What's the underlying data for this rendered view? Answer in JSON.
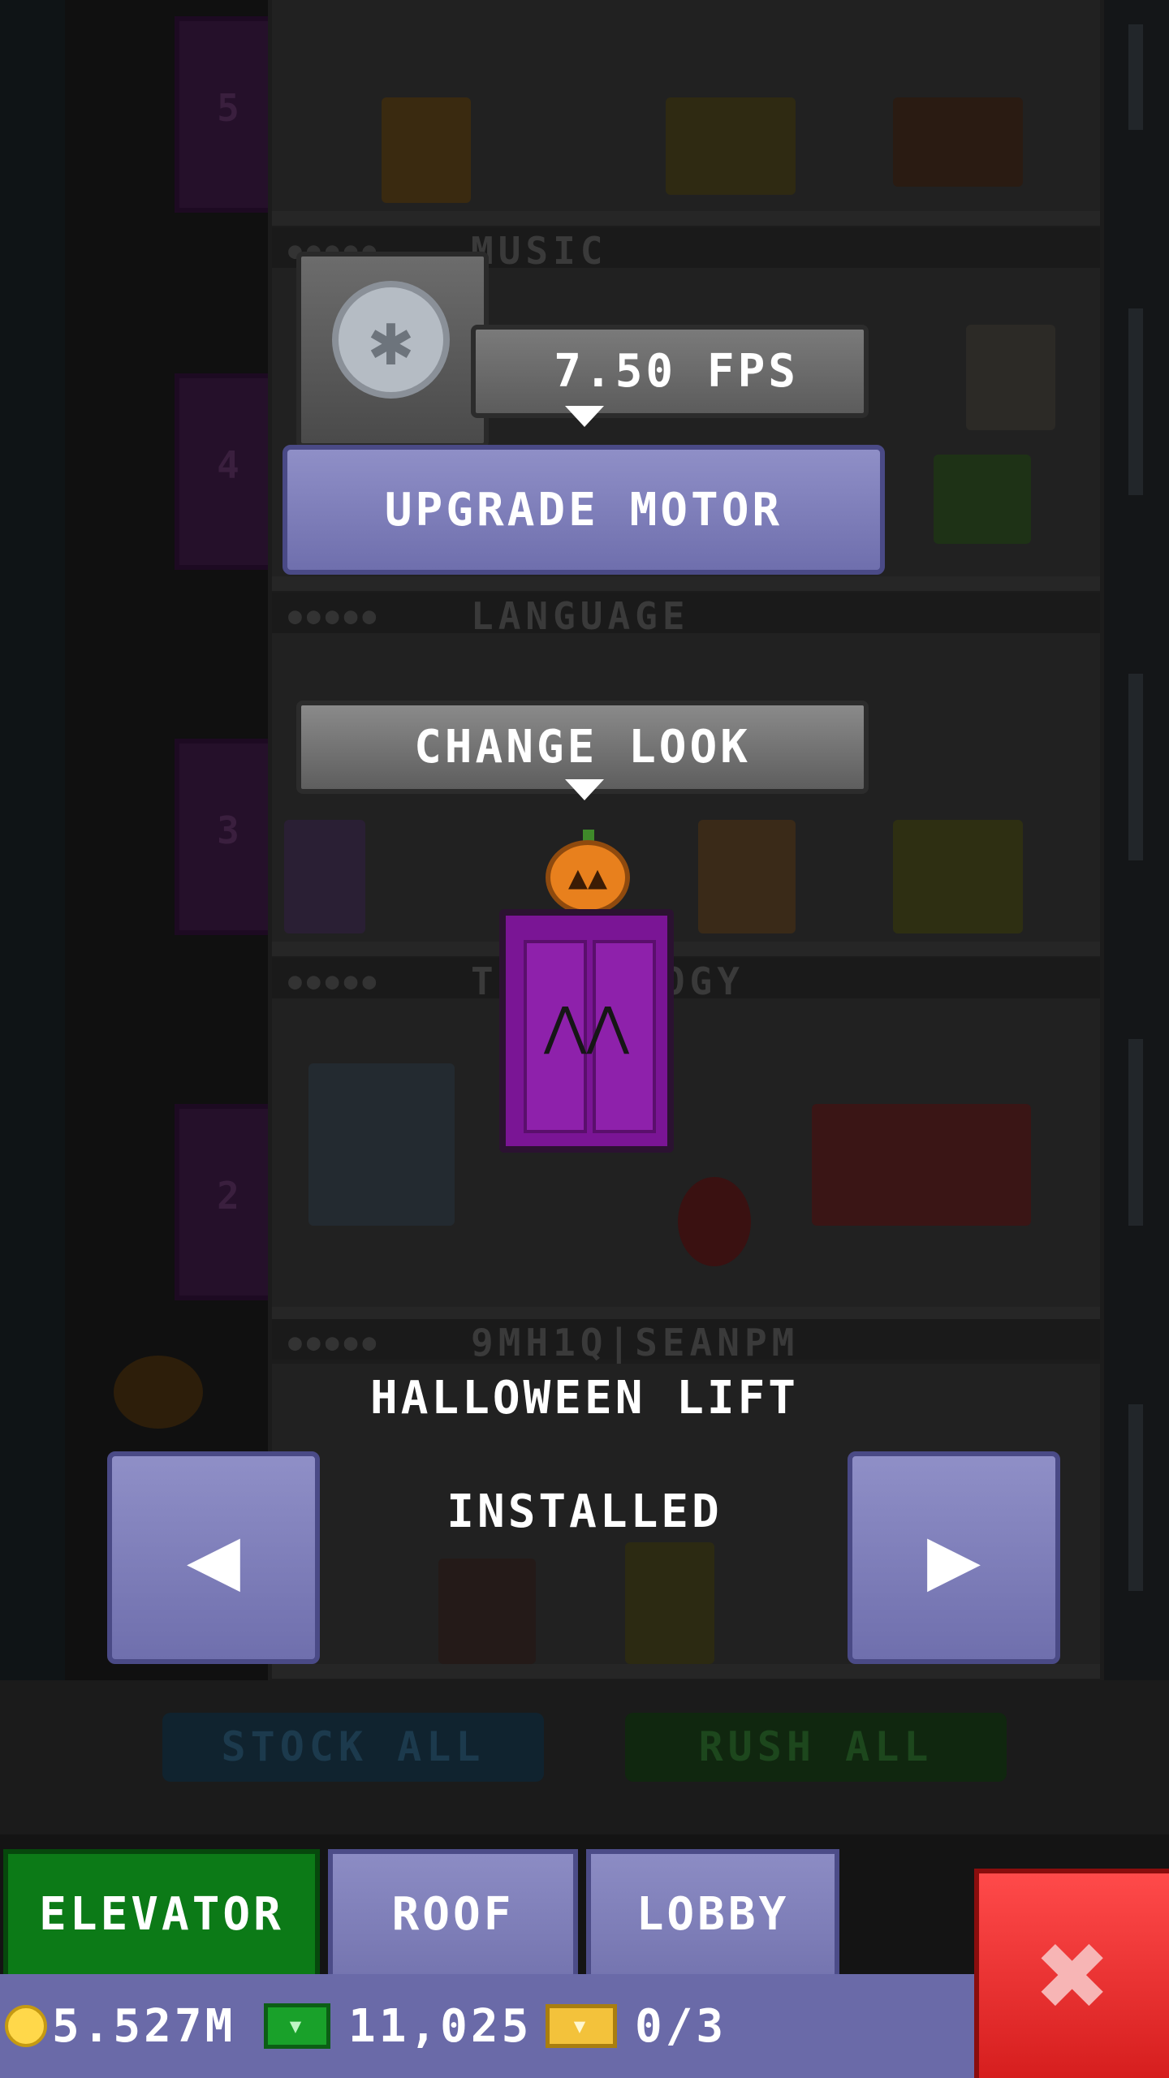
{
  "elevator": {
    "speed_readout": "7.50 FPS",
    "upgrade_button": "UPGRADE MOTOR",
    "change_look_button": "CHANGE LOOK",
    "lift_name": "HALLOWEEN LIFT",
    "lift_status": "INSTALLED",
    "prev_arrow": "◀",
    "next_arrow": "▶"
  },
  "background": {
    "floors": [
      {
        "number": "5",
        "name": "MUSIC"
      },
      {
        "number": "4",
        "name": "LANGUAGE"
      },
      {
        "number": "3",
        "name": "TECHNOLOGY"
      },
      {
        "number": "2",
        "name": "9MH1Q|SEANPM"
      }
    ],
    "stock_all": "STOCK ALL",
    "rush_all": "RUSH ALL"
  },
  "tabs": [
    {
      "label": "ELEVATOR",
      "active": true
    },
    {
      "label": "ROOF",
      "active": false
    },
    {
      "label": "LOBBY",
      "active": false
    }
  ],
  "status": {
    "coins": "5.527M",
    "bux": "11,025",
    "tickets": "0/3"
  },
  "icons": {
    "coin": "coin-icon",
    "bux": "tower-bux-icon",
    "ticket": "vip-ticket-icon",
    "close": "close-icon",
    "motor": "motor-icon"
  },
  "colors": {
    "primary_button": "#7f7fbd",
    "active_tab": "#0c7a17",
    "close_button": "#e42a2a",
    "lift_purple": "#7a1595"
  }
}
